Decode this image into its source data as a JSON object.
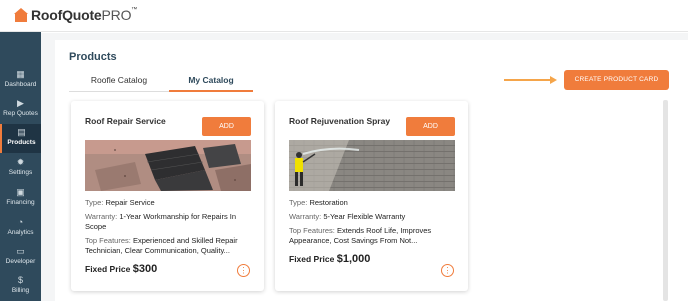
{
  "app": {
    "logo_brand": "RoofQuote",
    "logo_suffix": "PRO",
    "logo_tm": "™"
  },
  "sidebar": {
    "items": [
      {
        "label": "Dashboard",
        "icon": "dashboard-icon",
        "glyph": "▦"
      },
      {
        "label": "Rep Quotes",
        "icon": "play-circle-icon",
        "glyph": "▶"
      },
      {
        "label": "Products",
        "icon": "products-icon",
        "glyph": "▤"
      },
      {
        "label": "Settings",
        "icon": "gear-icon",
        "glyph": "✹"
      },
      {
        "label": "Financing",
        "icon": "calendar-icon",
        "glyph": "▣"
      },
      {
        "label": "Analytics",
        "icon": "pie-chart-icon",
        "glyph": "◔"
      },
      {
        "label": "Developer",
        "icon": "terminal-icon",
        "glyph": "▭"
      },
      {
        "label": "Billing",
        "icon": "dollar-icon",
        "glyph": "$"
      }
    ],
    "active": "Products"
  },
  "main": {
    "title": "Products",
    "tabs": [
      {
        "label": "Roofle Catalog",
        "active": false
      },
      {
        "label": "My Catalog",
        "active": true
      }
    ],
    "create_button": "CREATE PRODUCT CARD"
  },
  "cards": [
    {
      "title": "Roof Repair Service",
      "add_label": "ADD",
      "type_label": "Type:",
      "type_value": "Repair Service",
      "warranty_label": "Warranty:",
      "warranty_value": "1-Year Workmanship for Repairs In Scope",
      "features_label": "Top Features:",
      "features_value": "Experienced and Skilled Repair Technician, Clear Communication, Quality...",
      "price_label": "Fixed Price",
      "price_value": "$300"
    },
    {
      "title": "Roof Rejuvenation Spray",
      "add_label": "ADD",
      "type_label": "Type:",
      "type_value": "Restoration",
      "warranty_label": "Warranty:",
      "warranty_value": "5-Year Flexible Warranty",
      "features_label": "Top Features:",
      "features_value": "Extends Roof Life, Improves Appearance, Cost Savings From Not...",
      "price_label": "Fixed Price",
      "price_value": "$1,000"
    }
  ],
  "colors": {
    "accent": "#f07c3c",
    "sidebar": "#2f4a5c",
    "title": "#2f4a5c"
  }
}
